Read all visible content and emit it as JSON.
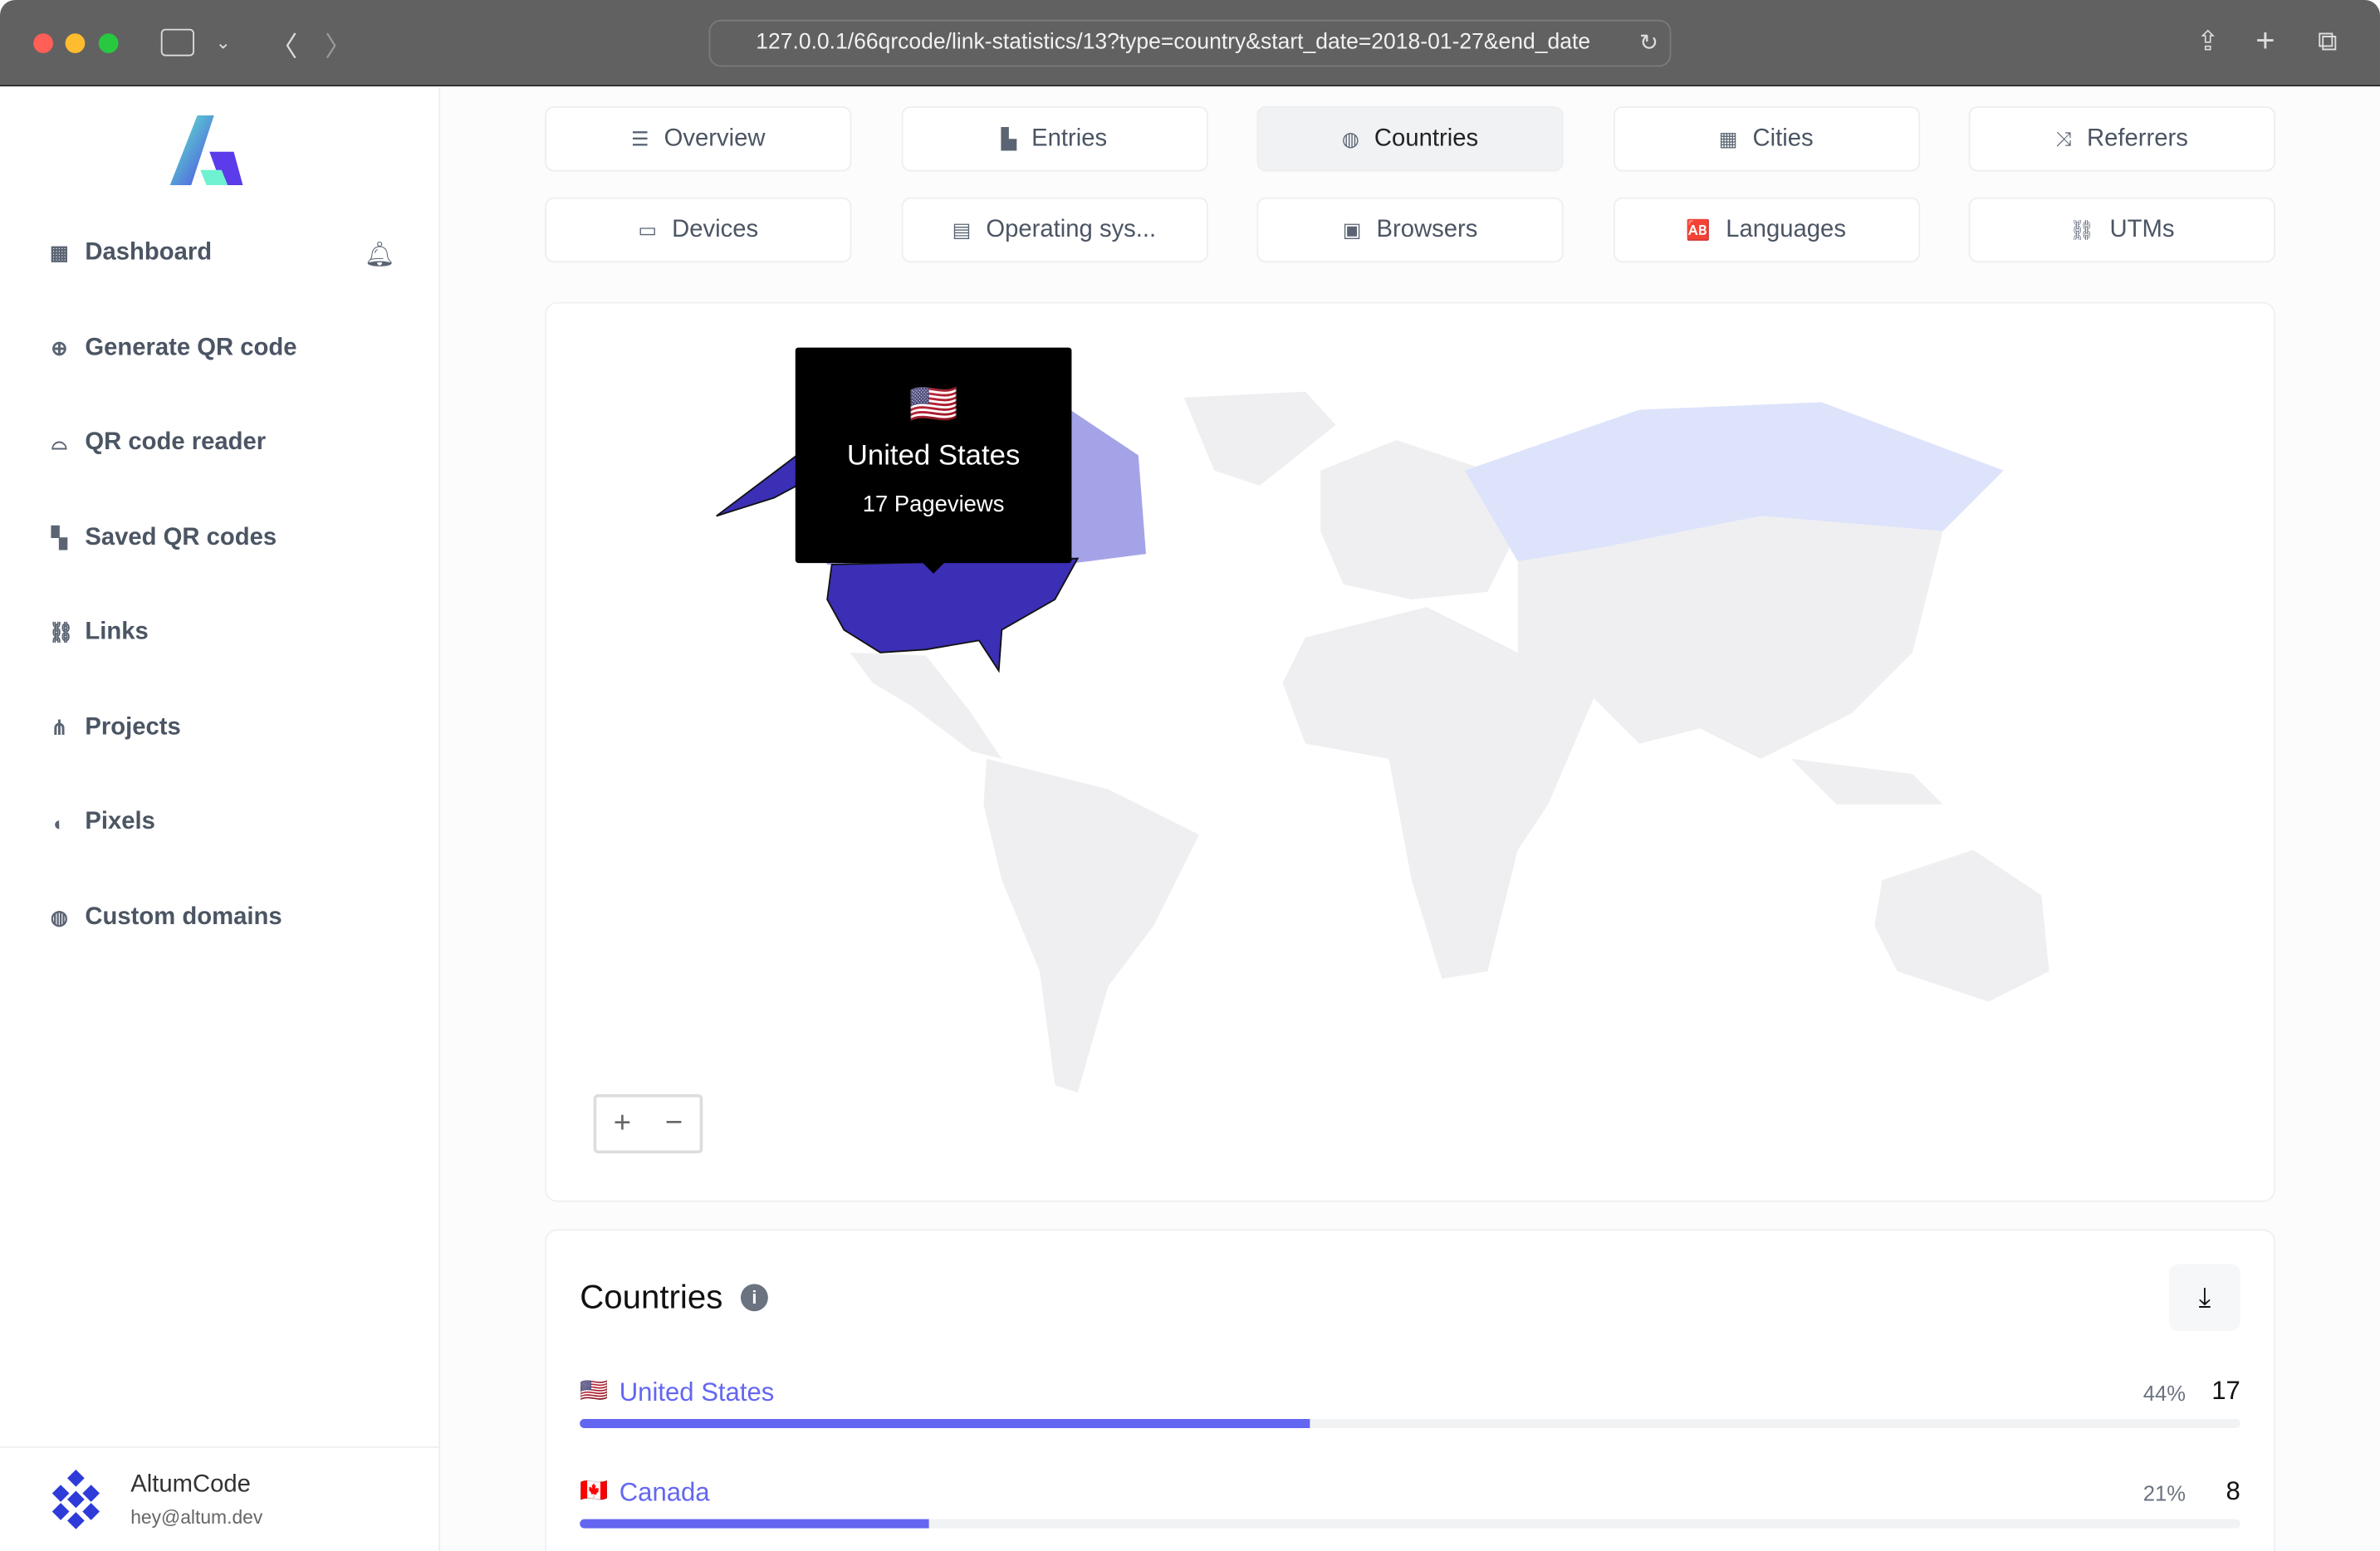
{
  "browser": {
    "url": "127.0.0.1/66qrcode/link-statistics/13?type=country&start_date=2018-01-27&end_date"
  },
  "sidebar": {
    "items": [
      {
        "label": "Dashboard",
        "icon": "grid-icon"
      },
      {
        "label": "Generate QR code",
        "icon": "plus-circle-icon"
      },
      {
        "label": "QR code reader",
        "icon": "glasses-icon"
      },
      {
        "label": "Saved QR codes",
        "icon": "qrcode-icon"
      },
      {
        "label": "Links",
        "icon": "link-icon"
      },
      {
        "label": "Projects",
        "icon": "project-diagram-icon"
      },
      {
        "label": "Pixels",
        "icon": "adjust-icon"
      },
      {
        "label": "Custom domains",
        "icon": "globe-icon"
      }
    ],
    "user": {
      "name": "AltumCode",
      "email": "hey@altum.dev"
    }
  },
  "tabs": [
    {
      "label": "Overview",
      "icon": "list-icon",
      "glyph": "☰"
    },
    {
      "label": "Entries",
      "icon": "chart-bar-icon",
      "glyph": "▙"
    },
    {
      "label": "Countries",
      "icon": "globe-icon",
      "glyph": "◍",
      "active": true
    },
    {
      "label": "Cities",
      "icon": "city-icon",
      "glyph": "▦"
    },
    {
      "label": "Referrers",
      "icon": "random-icon",
      "glyph": "⤨"
    },
    {
      "label": "Devices",
      "icon": "laptop-icon",
      "glyph": "▭"
    },
    {
      "label": "Operating sys...",
      "icon": "server-icon",
      "glyph": "▤"
    },
    {
      "label": "Browsers",
      "icon": "window-icon",
      "glyph": "▣"
    },
    {
      "label": "Languages",
      "icon": "language-icon",
      "glyph": "🆎"
    },
    {
      "label": "UTMs",
      "icon": "link-icon",
      "glyph": "⛓"
    }
  ],
  "map": {
    "tooltip": {
      "country": "United States",
      "value": "17 Pageviews"
    },
    "colors": {
      "max": "#3b2fb5",
      "mid": "#a5a3e8",
      "low": "#dde3fb",
      "none": "#efeff1"
    }
  },
  "countries": {
    "title": "Countries",
    "rows": [
      {
        "name": "United States",
        "percent": "44%",
        "value": "17",
        "fraction": 0.44
      },
      {
        "name": "Canada",
        "percent": "21%",
        "value": "8",
        "fraction": 0.21
      }
    ]
  },
  "accent": "#6366f1"
}
